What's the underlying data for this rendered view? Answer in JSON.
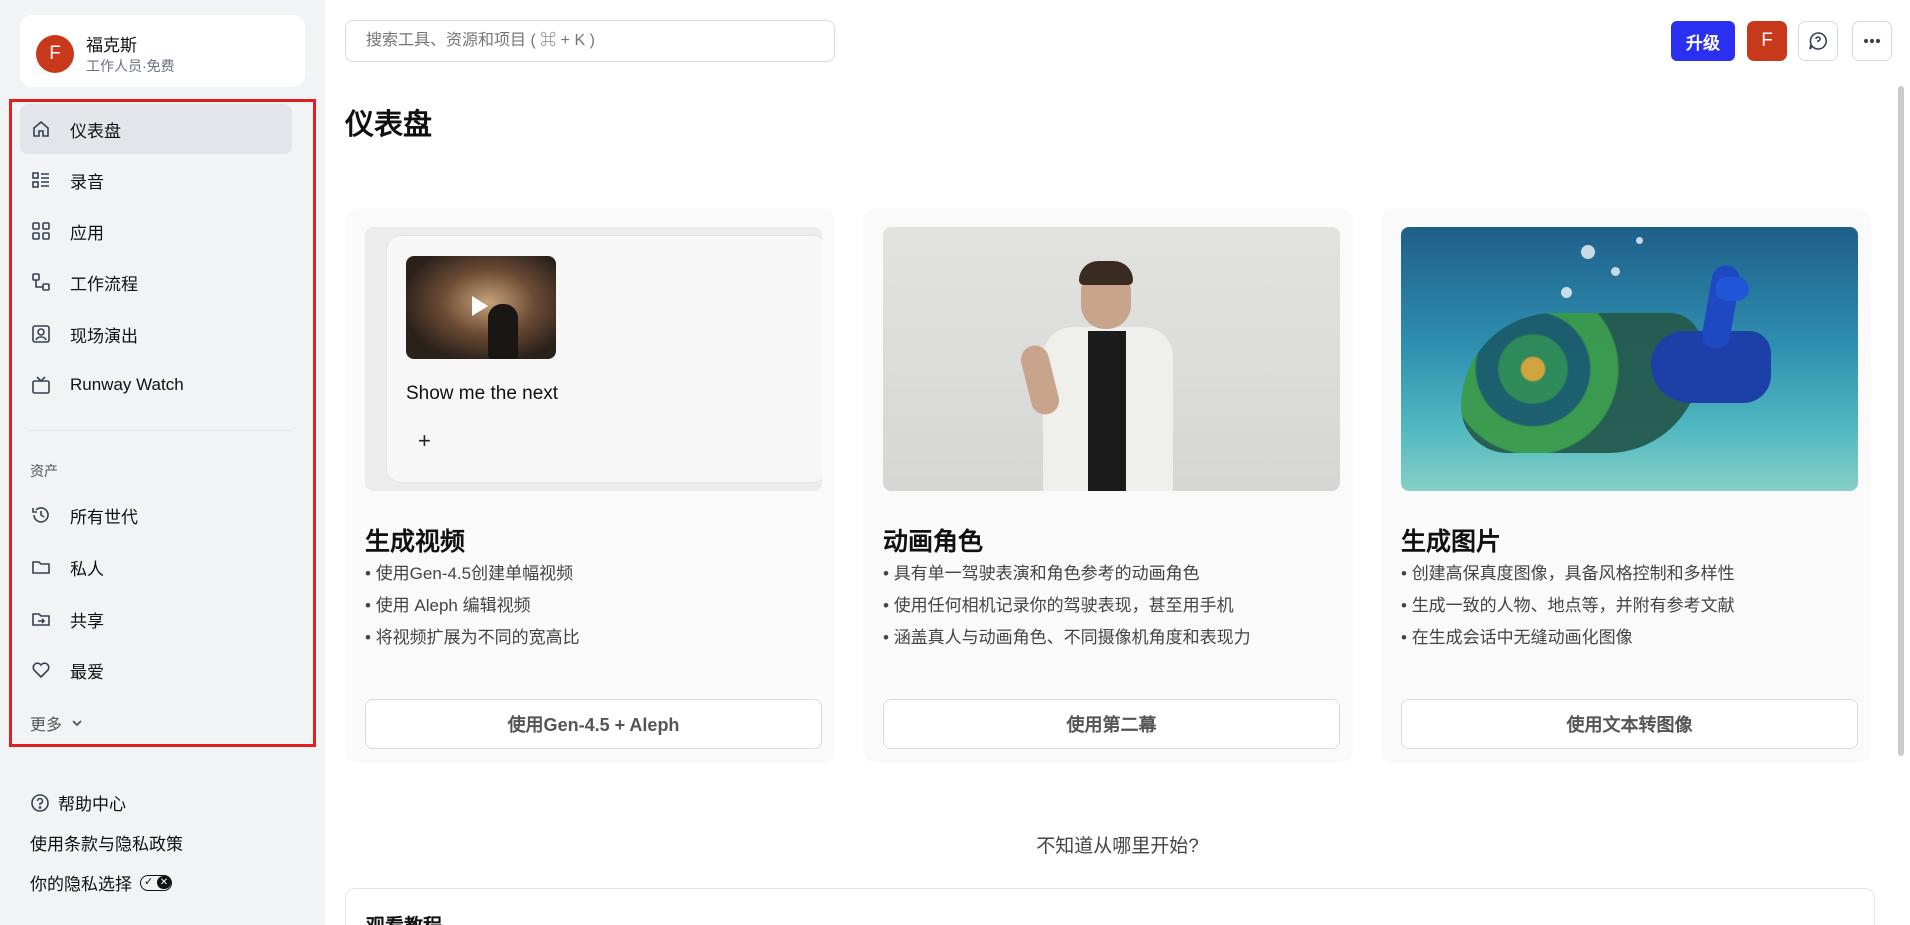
{
  "account": {
    "initial": "F",
    "name": "福克斯",
    "plan": "工作人员·免费"
  },
  "nav": {
    "items": [
      {
        "label": "仪表盘",
        "icon": "home-icon"
      },
      {
        "label": "录音",
        "icon": "list-icon"
      },
      {
        "label": "应用",
        "icon": "apps-grid-icon"
      },
      {
        "label": "工作流程",
        "icon": "workflow-icon"
      },
      {
        "label": "现场演出",
        "icon": "live-icon"
      },
      {
        "label": "Runway Watch",
        "icon": "tv-icon"
      }
    ],
    "assets_label": "资产",
    "assets": [
      {
        "label": "所有世代",
        "icon": "history-icon"
      },
      {
        "label": "私人",
        "icon": "folder-icon"
      },
      {
        "label": "共享",
        "icon": "shared-folder-icon"
      },
      {
        "label": "最爱",
        "icon": "heart-icon"
      }
    ],
    "more_label": "更多"
  },
  "footer": {
    "help": "帮助中心",
    "terms": "使用条款与隐私政策",
    "privacy": "你的隐私选择"
  },
  "header": {
    "search_placeholder": "搜索工具、资源和项目 ( ⌘ + K )",
    "upgrade_label": "升级",
    "avatar_initial": "F"
  },
  "page": {
    "title": "仪表盘"
  },
  "cards": [
    {
      "title": "生成视频",
      "bullets": [
        "使用Gen-4.5创建单幅视频",
        "使用 Aleph 编辑视频",
        "将视频扩展为不同的宽高比"
      ],
      "cta": "使用Gen-4.5 + Aleph",
      "preview_text": "Show me the next"
    },
    {
      "title": "动画角色",
      "bullets": [
        "具有单一驾驶表演和角色参考的动画角色",
        "使用任何相机记录你的驾驶表现，甚至用手机",
        "涵盖真人与动画角色、不同摄像机角度和表现力"
      ],
      "cta": "使用第二幕"
    },
    {
      "title": "生成图片",
      "bullets": [
        "创建高保真度图像，具备风格控制和多样性",
        "生成一致的人物、地点等，并附有参考文献",
        "在生成会话中无缝动画化图像"
      ],
      "cta": "使用文本转图像"
    }
  ],
  "hint": "不知道从哪里开始?",
  "tutorial": {
    "title": "观看教程"
  }
}
